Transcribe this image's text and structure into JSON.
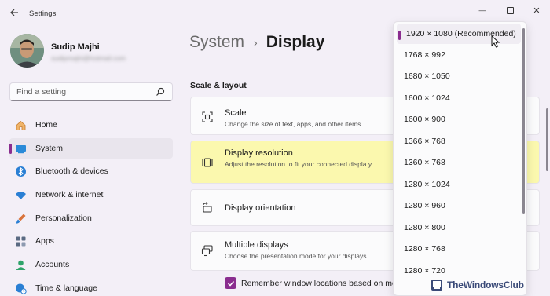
{
  "window": {
    "title": "Settings",
    "controls": {
      "minimize": "—",
      "close": "✕"
    }
  },
  "profile": {
    "name": "Sudip Majhi",
    "email": "sudipmajhi@hotmail.com"
  },
  "search": {
    "placeholder": "Find a setting"
  },
  "sidebar": {
    "items": [
      {
        "label": "Home",
        "icon": "home-icon",
        "selected": false
      },
      {
        "label": "System",
        "icon": "system-icon",
        "selected": true
      },
      {
        "label": "Bluetooth & devices",
        "icon": "bluetooth-icon",
        "selected": false
      },
      {
        "label": "Network & internet",
        "icon": "wifi-icon",
        "selected": false
      },
      {
        "label": "Personalization",
        "icon": "brush-icon",
        "selected": false
      },
      {
        "label": "Apps",
        "icon": "apps-icon",
        "selected": false
      },
      {
        "label": "Accounts",
        "icon": "accounts-icon",
        "selected": false
      },
      {
        "label": "Time & language",
        "icon": "globe-clock-icon",
        "selected": false
      }
    ]
  },
  "header": {
    "breadcrumb_parent": "System",
    "breadcrumb_separator": "›",
    "breadcrumb_current": "Display"
  },
  "main": {
    "section_title": "Scale & layout",
    "cards": [
      {
        "title": "Scale",
        "subtitle": "Change the size of text, apps, and other items",
        "icon": "scale-icon"
      },
      {
        "title": "Display resolution",
        "subtitle": "Adjust the resolution to fit your connected displa y",
        "icon": "resolution-icon"
      },
      {
        "title": "Display orientation",
        "subtitle": "",
        "icon": "orientation-icon"
      },
      {
        "title": "Multiple displays",
        "subtitle": "Choose the presentation mode for your displays",
        "icon": "multiple-displays-icon"
      }
    ],
    "checkbox": {
      "label": "Remember window locations based on monitor connection",
      "checked": true
    }
  },
  "resolution_dropdown": {
    "options": [
      "1920 × 1080 (Recommended)",
      "1768 × 992",
      "1680 × 1050",
      "1600 × 1024",
      "1600 × 900",
      "1366 × 768",
      "1360 × 768",
      "1280 × 1024",
      "1280 × 960",
      "1280 × 800",
      "1280 × 768",
      "1280 × 720"
    ],
    "selected_index": 0
  },
  "watermark": {
    "text": "TheWindowsClub"
  },
  "colors": {
    "accent": "#8a2d8f",
    "highlight": "#fbf8ae",
    "background": "#f3eff7"
  }
}
